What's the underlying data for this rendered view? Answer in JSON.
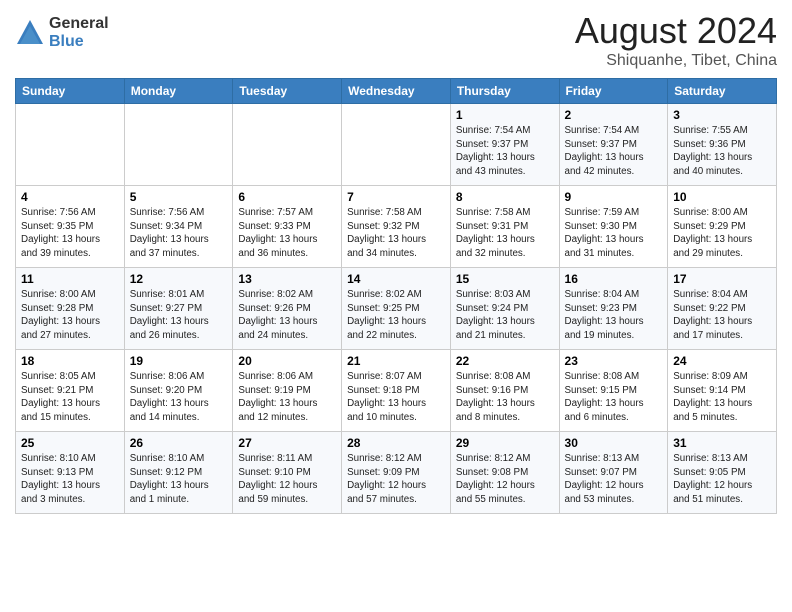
{
  "logo": {
    "general": "General",
    "blue": "Blue"
  },
  "title": "August 2024",
  "subtitle": "Shiquanhe, Tibet, China",
  "weekdays": [
    "Sunday",
    "Monday",
    "Tuesday",
    "Wednesday",
    "Thursday",
    "Friday",
    "Saturday"
  ],
  "weeks": [
    [
      {
        "day": "",
        "info": ""
      },
      {
        "day": "",
        "info": ""
      },
      {
        "day": "",
        "info": ""
      },
      {
        "day": "",
        "info": ""
      },
      {
        "day": "1",
        "info": "Sunrise: 7:54 AM\nSunset: 9:37 PM\nDaylight: 13 hours\nand 43 minutes."
      },
      {
        "day": "2",
        "info": "Sunrise: 7:54 AM\nSunset: 9:37 PM\nDaylight: 13 hours\nand 42 minutes."
      },
      {
        "day": "3",
        "info": "Sunrise: 7:55 AM\nSunset: 9:36 PM\nDaylight: 13 hours\nand 40 minutes."
      }
    ],
    [
      {
        "day": "4",
        "info": "Sunrise: 7:56 AM\nSunset: 9:35 PM\nDaylight: 13 hours\nand 39 minutes."
      },
      {
        "day": "5",
        "info": "Sunrise: 7:56 AM\nSunset: 9:34 PM\nDaylight: 13 hours\nand 37 minutes."
      },
      {
        "day": "6",
        "info": "Sunrise: 7:57 AM\nSunset: 9:33 PM\nDaylight: 13 hours\nand 36 minutes."
      },
      {
        "day": "7",
        "info": "Sunrise: 7:58 AM\nSunset: 9:32 PM\nDaylight: 13 hours\nand 34 minutes."
      },
      {
        "day": "8",
        "info": "Sunrise: 7:58 AM\nSunset: 9:31 PM\nDaylight: 13 hours\nand 32 minutes."
      },
      {
        "day": "9",
        "info": "Sunrise: 7:59 AM\nSunset: 9:30 PM\nDaylight: 13 hours\nand 31 minutes."
      },
      {
        "day": "10",
        "info": "Sunrise: 8:00 AM\nSunset: 9:29 PM\nDaylight: 13 hours\nand 29 minutes."
      }
    ],
    [
      {
        "day": "11",
        "info": "Sunrise: 8:00 AM\nSunset: 9:28 PM\nDaylight: 13 hours\nand 27 minutes."
      },
      {
        "day": "12",
        "info": "Sunrise: 8:01 AM\nSunset: 9:27 PM\nDaylight: 13 hours\nand 26 minutes."
      },
      {
        "day": "13",
        "info": "Sunrise: 8:02 AM\nSunset: 9:26 PM\nDaylight: 13 hours\nand 24 minutes."
      },
      {
        "day": "14",
        "info": "Sunrise: 8:02 AM\nSunset: 9:25 PM\nDaylight: 13 hours\nand 22 minutes."
      },
      {
        "day": "15",
        "info": "Sunrise: 8:03 AM\nSunset: 9:24 PM\nDaylight: 13 hours\nand 21 minutes."
      },
      {
        "day": "16",
        "info": "Sunrise: 8:04 AM\nSunset: 9:23 PM\nDaylight: 13 hours\nand 19 minutes."
      },
      {
        "day": "17",
        "info": "Sunrise: 8:04 AM\nSunset: 9:22 PM\nDaylight: 13 hours\nand 17 minutes."
      }
    ],
    [
      {
        "day": "18",
        "info": "Sunrise: 8:05 AM\nSunset: 9:21 PM\nDaylight: 13 hours\nand 15 minutes."
      },
      {
        "day": "19",
        "info": "Sunrise: 8:06 AM\nSunset: 9:20 PM\nDaylight: 13 hours\nand 14 minutes."
      },
      {
        "day": "20",
        "info": "Sunrise: 8:06 AM\nSunset: 9:19 PM\nDaylight: 13 hours\nand 12 minutes."
      },
      {
        "day": "21",
        "info": "Sunrise: 8:07 AM\nSunset: 9:18 PM\nDaylight: 13 hours\nand 10 minutes."
      },
      {
        "day": "22",
        "info": "Sunrise: 8:08 AM\nSunset: 9:16 PM\nDaylight: 13 hours\nand 8 minutes."
      },
      {
        "day": "23",
        "info": "Sunrise: 8:08 AM\nSunset: 9:15 PM\nDaylight: 13 hours\nand 6 minutes."
      },
      {
        "day": "24",
        "info": "Sunrise: 8:09 AM\nSunset: 9:14 PM\nDaylight: 13 hours\nand 5 minutes."
      }
    ],
    [
      {
        "day": "25",
        "info": "Sunrise: 8:10 AM\nSunset: 9:13 PM\nDaylight: 13 hours\nand 3 minutes."
      },
      {
        "day": "26",
        "info": "Sunrise: 8:10 AM\nSunset: 9:12 PM\nDaylight: 13 hours\nand 1 minute."
      },
      {
        "day": "27",
        "info": "Sunrise: 8:11 AM\nSunset: 9:10 PM\nDaylight: 12 hours\nand 59 minutes."
      },
      {
        "day": "28",
        "info": "Sunrise: 8:12 AM\nSunset: 9:09 PM\nDaylight: 12 hours\nand 57 minutes."
      },
      {
        "day": "29",
        "info": "Sunrise: 8:12 AM\nSunset: 9:08 PM\nDaylight: 12 hours\nand 55 minutes."
      },
      {
        "day": "30",
        "info": "Sunrise: 8:13 AM\nSunset: 9:07 PM\nDaylight: 12 hours\nand 53 minutes."
      },
      {
        "day": "31",
        "info": "Sunrise: 8:13 AM\nSunset: 9:05 PM\nDaylight: 12 hours\nand 51 minutes."
      }
    ]
  ]
}
